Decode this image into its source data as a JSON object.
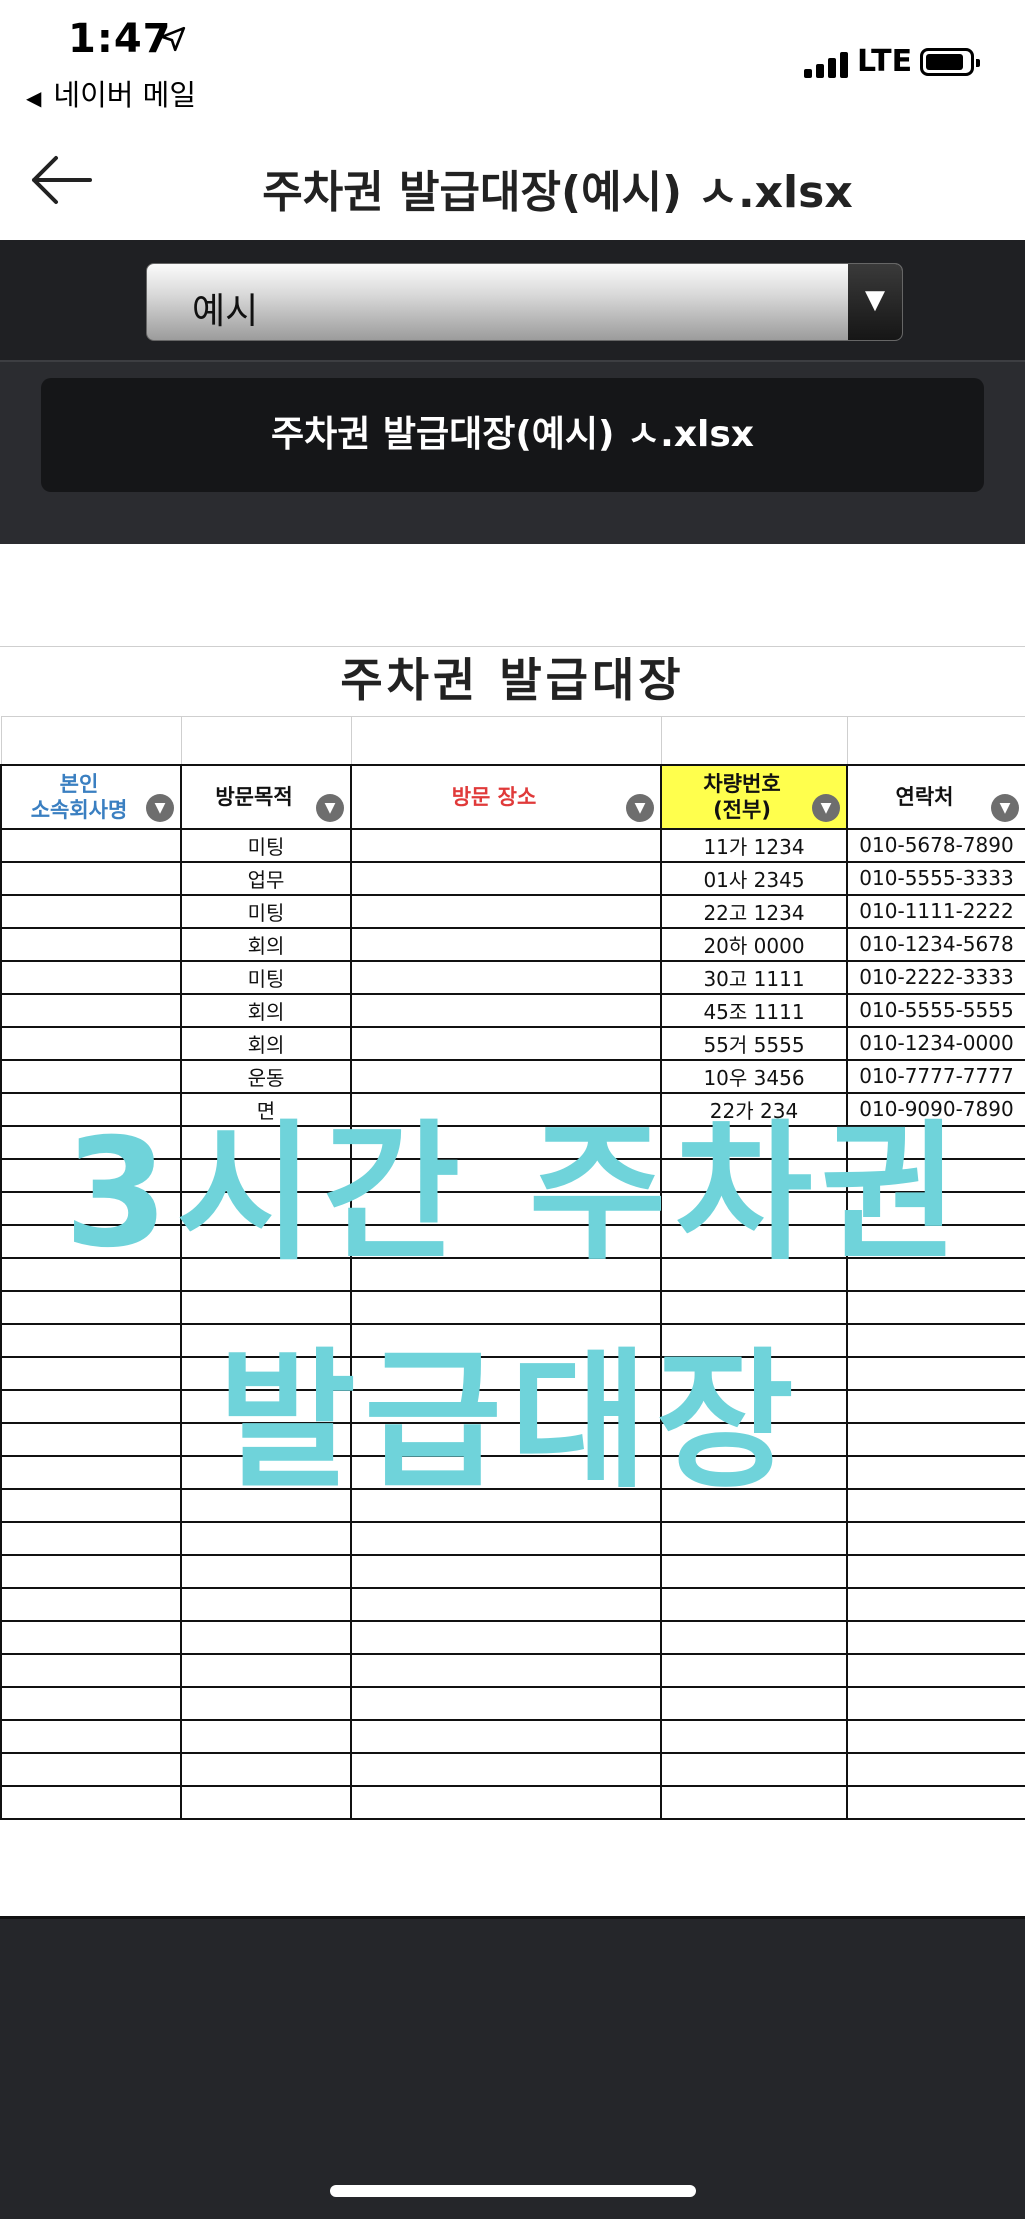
{
  "status_bar": {
    "time": "1:47",
    "back_app": "네이버 메일",
    "network": "LTE"
  },
  "header": {
    "title": "주차권 발급대장(예시) ㅅ.xlsx"
  },
  "toolbar": {
    "sheet_select_value": "예시",
    "file_tab_label": "주차권 발급대장(예시) ㅅ.xlsx"
  },
  "sheet": {
    "title": "주차권 발급대장",
    "columns": [
      {
        "label": "본인\n소속회사명",
        "color": "#3a7fc1"
      },
      {
        "label": "방문목적",
        "color": "#111111"
      },
      {
        "label": "방문 장소",
        "color": "#e03a3a"
      },
      {
        "label": "차량번호\n(전부)",
        "color": "#111111",
        "bg": "#ffff4d"
      },
      {
        "label": "연락처",
        "color": "#111111"
      }
    ],
    "rows": [
      [
        "",
        "미팅",
        "",
        "11가 1234",
        "010-5678-7890"
      ],
      [
        "",
        "업무",
        "",
        "01사 2345",
        "010-5555-3333"
      ],
      [
        "",
        "미팅",
        "",
        "22고 1234",
        "010-1111-2222"
      ],
      [
        "",
        "회의",
        "",
        "20하 0000",
        "010-1234-5678"
      ],
      [
        "",
        "미팅",
        "",
        "30고 1111",
        "010-2222-3333"
      ],
      [
        "",
        "회의",
        "",
        "45조 1111",
        "010-5555-5555"
      ],
      [
        "",
        "회의",
        "",
        "55거 5555",
        "010-1234-0000"
      ],
      [
        "",
        "운동",
        "",
        "10우 3456",
        "010-7777-7777"
      ],
      [
        "",
        "면",
        "",
        "22가 234",
        "010-9090-7890"
      ],
      [
        "",
        "",
        "",
        "",
        ""
      ],
      [
        "",
        "",
        "",
        "",
        ""
      ],
      [
        "",
        "",
        "",
        "",
        ""
      ],
      [
        "",
        "",
        "",
        "",
        ""
      ],
      [
        "",
        "",
        "",
        "",
        ""
      ],
      [
        "",
        "",
        "",
        "",
        ""
      ],
      [
        "",
        "",
        "",
        "",
        ""
      ],
      [
        "",
        "",
        "",
        "",
        ""
      ],
      [
        "",
        "",
        "",
        "",
        ""
      ],
      [
        "",
        "",
        "",
        "",
        ""
      ],
      [
        "",
        "",
        "",
        "",
        ""
      ],
      [
        "",
        "",
        "",
        "",
        ""
      ],
      [
        "",
        "",
        "",
        "",
        ""
      ],
      [
        "",
        "",
        "",
        "",
        ""
      ],
      [
        "",
        "",
        "",
        "",
        ""
      ],
      [
        "",
        "",
        "",
        "",
        ""
      ],
      [
        "",
        "",
        "",
        "",
        ""
      ],
      [
        "",
        "",
        "",
        "",
        ""
      ],
      [
        "",
        "",
        "",
        "",
        ""
      ],
      [
        "",
        "",
        "",
        "",
        ""
      ],
      [
        "",
        "",
        "",
        "",
        ""
      ]
    ]
  },
  "watermark": {
    "line1": "3시간 주차권",
    "line2": "발급대장",
    "color": "#6fd3da"
  }
}
